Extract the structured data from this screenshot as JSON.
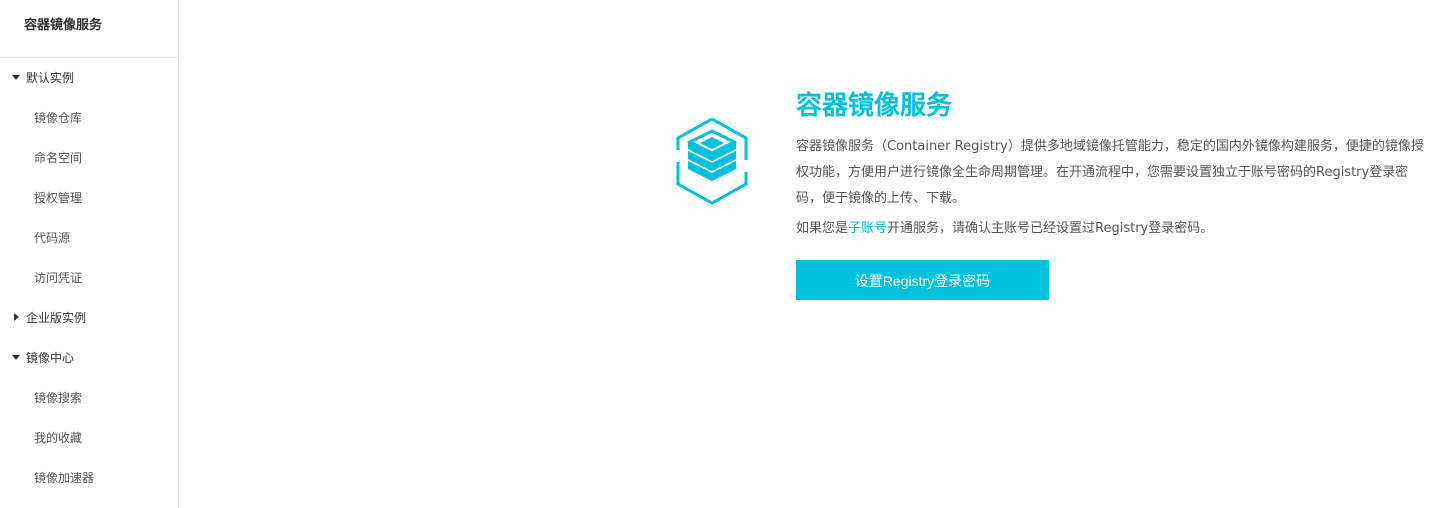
{
  "sidebar": {
    "title": "容器镜像服务",
    "groups": [
      {
        "label": "默认实例",
        "expanded": true,
        "items": [
          {
            "label": "镜像仓库"
          },
          {
            "label": "命名空间"
          },
          {
            "label": "授权管理"
          },
          {
            "label": "代码源"
          },
          {
            "label": "访问凭证"
          }
        ]
      },
      {
        "label": "企业版实例",
        "expanded": false,
        "items": []
      },
      {
        "label": "镜像中心",
        "expanded": true,
        "items": [
          {
            "label": "镜像搜索"
          },
          {
            "label": "我的收藏"
          },
          {
            "label": "镜像加速器"
          }
        ]
      }
    ]
  },
  "main": {
    "logo_icon": "container-registry-hexagon-stack-icon",
    "title": "容器镜像服务",
    "description": "容器镜像服务（Container Registry）提供多地域镜像托管能力，稳定的国内外镜像构建服务，便捷的镜像授权功能，方便用户进行镜像全生命周期管理。在开通流程中，您需要设置独立于账号密码的Registry登录密码，便于镜像的上传、下载。",
    "note_prefix": "如果您是",
    "note_link": "子账号",
    "note_suffix": "开通服务，请确认主账号已经设置过Registry登录密码。",
    "button_label": "设置Registry登录密码"
  },
  "colors": {
    "accent": "#00c1de",
    "text": "#555555",
    "border": "#e5e5e5"
  }
}
